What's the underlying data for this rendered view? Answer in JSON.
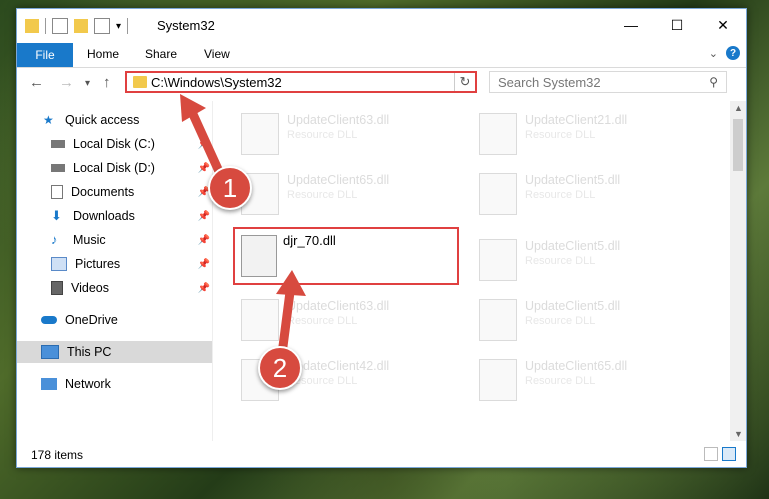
{
  "window": {
    "title": "System32"
  },
  "ribbon": {
    "tabs": [
      "File",
      "Home",
      "Share",
      "View"
    ]
  },
  "address": {
    "path": "C:\\Windows\\System32",
    "search_placeholder": "Search System32"
  },
  "sidebar": {
    "items": [
      {
        "label": "Quick access"
      },
      {
        "label": "Local Disk (C:)"
      },
      {
        "label": "Local Disk (D:)"
      },
      {
        "label": "Documents"
      },
      {
        "label": "Downloads"
      },
      {
        "label": "Music"
      },
      {
        "label": "Pictures"
      },
      {
        "label": "Videos"
      },
      {
        "label": "OneDrive"
      },
      {
        "label": "This PC"
      },
      {
        "label": "Network"
      }
    ]
  },
  "files": [
    {
      "name": "UpdateClient63.dll",
      "type": "Resource DLL"
    },
    {
      "name": "UpdateClient21.dll",
      "type": "Resource DLL"
    },
    {
      "name": "UpdateClient65.dll",
      "type": "Resource DLL"
    },
    {
      "name": "UpdateClient5.dll",
      "type": "Resource DLL"
    },
    {
      "name": "djr_70.dll",
      "type": ""
    },
    {
      "name": "UpdateClient5.dll",
      "type": "Resource DLL"
    },
    {
      "name": "UpdateClient63.dll",
      "type": "Resource DLL"
    },
    {
      "name": "UpdateClient5.dll",
      "type": "Resource DLL"
    },
    {
      "name": "UpdateClient42.dll",
      "type": "Resource DLL"
    },
    {
      "name": "UpdateClient65.dll",
      "type": "Resource DLL"
    }
  ],
  "status": {
    "items": "178 items"
  },
  "annotations": {
    "step1": "1",
    "step2": "2"
  },
  "colors": {
    "accent": "#1979ca",
    "highlight": "#e04040",
    "badge": "#d74a3f"
  }
}
